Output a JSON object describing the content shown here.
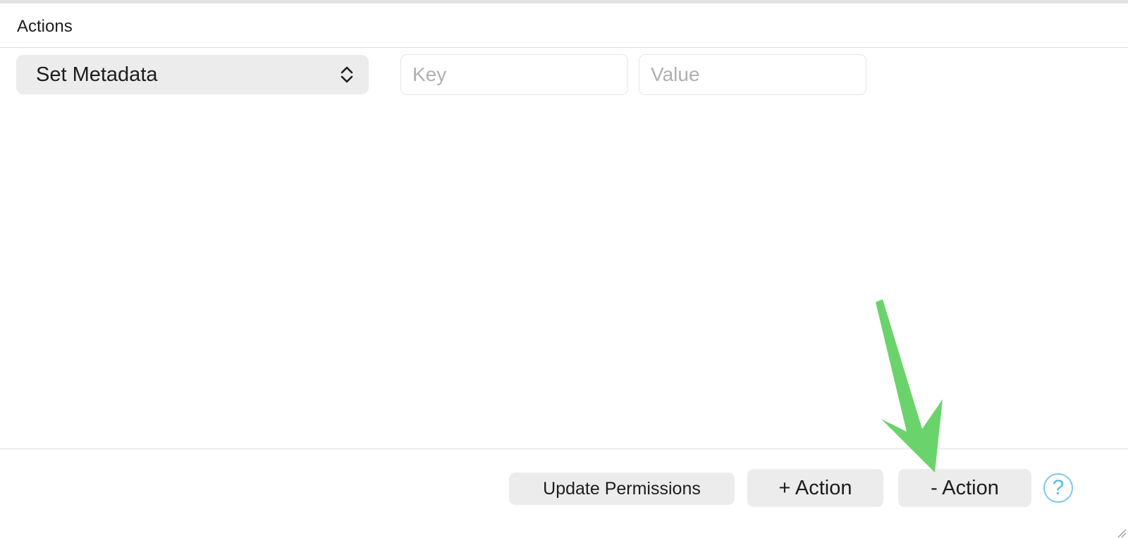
{
  "section": {
    "title": "Actions"
  },
  "action_row": {
    "action_type": "Set Metadata",
    "key_placeholder": "Key",
    "key_value": "",
    "value_placeholder": "Value",
    "value_value": ""
  },
  "footer": {
    "update_permissions_label": "Update Permissions",
    "add_action_label": "+ Action",
    "remove_action_label": "- Action",
    "help_label": "?"
  },
  "annotation": {
    "arrow_color": "#6bd36b"
  }
}
